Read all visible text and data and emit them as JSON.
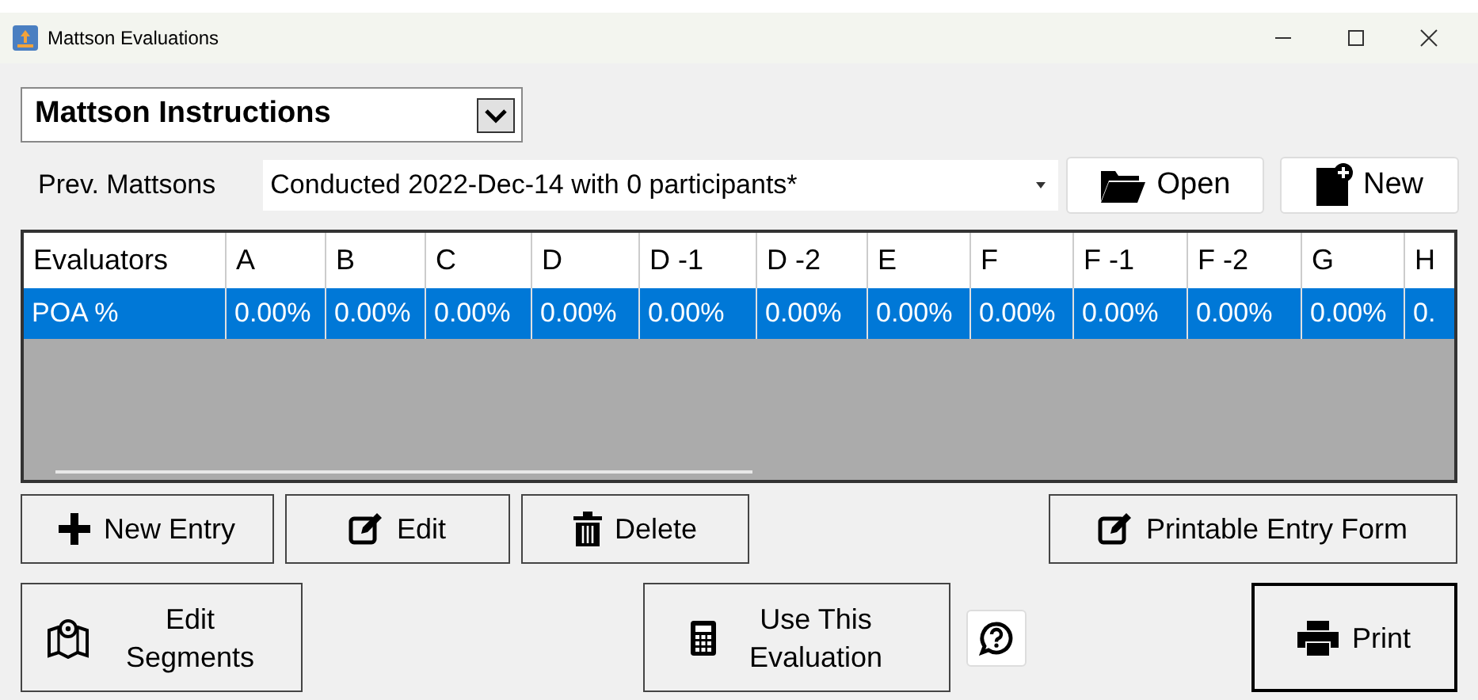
{
  "window": {
    "title": "Mattson Evaluations"
  },
  "instructions_dropdown": {
    "value": "Mattson Instructions"
  },
  "prev_mattsons": {
    "label": "Prev. Mattsons",
    "value": "Conducted 2022-Dec-14 with 0 participants*"
  },
  "top_buttons": [
    {
      "kind": "open",
      "label": "Open"
    },
    {
      "kind": "new",
      "label": "New"
    }
  ],
  "table": {
    "columns": [
      "Evaluators",
      "A",
      "B",
      "C",
      "D",
      "D -1",
      "D -2",
      "E",
      "F",
      "F -1",
      "F -2",
      "G",
      "H"
    ],
    "rows": [
      {
        "selected": true,
        "cells": [
          "POA %",
          "0.00%",
          "0.00%",
          "0.00%",
          "0.00%",
          "0.00%",
          "0.00%",
          "0.00%",
          "0.00%",
          "0.00%",
          "0.00%",
          "0.00%",
          "0."
        ]
      }
    ]
  },
  "entry_buttons": [
    {
      "kind": "plus",
      "label": "New Entry"
    },
    {
      "kind": "edit",
      "label": "Edit"
    },
    {
      "kind": "trash",
      "label": "Delete"
    },
    {
      "kind": "edit",
      "label": "Printable Entry Form"
    }
  ],
  "bottom_buttons": [
    {
      "kind": "map",
      "label": "Edit Segments"
    },
    {
      "kind": "calculator",
      "label": "Use This Evaluation"
    },
    {
      "kind": "help"
    },
    {
      "kind": "print",
      "label": "Print",
      "default": true
    }
  ]
}
